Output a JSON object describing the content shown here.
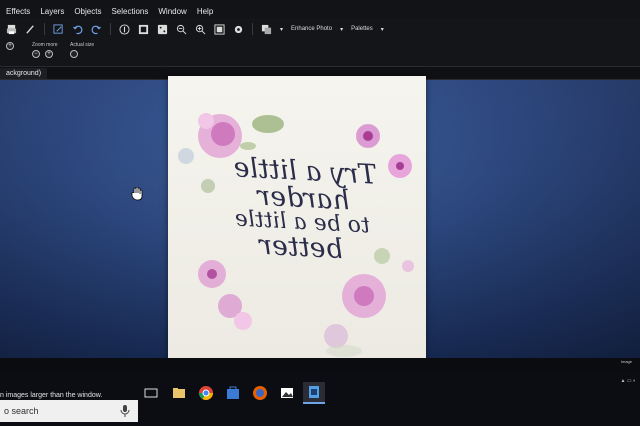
{
  "menu": {
    "items": [
      "Effects",
      "Layers",
      "Objects",
      "Selections",
      "Window",
      "Help"
    ]
  },
  "toolbar": {
    "enhance_label": "Enhance Photo",
    "palettes_label": "Palettes"
  },
  "options": {
    "zoom_label": "Zoom more",
    "actual_label": "Actual size",
    "zoom_out_glyph": "−",
    "zoom_in_glyph": "+"
  },
  "tab": {
    "label": "ackground)"
  },
  "artwork": {
    "line1": "Try a little",
    "line2": "harder",
    "line3": "to be a little",
    "line4": "better"
  },
  "status": {
    "hint": "n images larger than the window.",
    "image_info": "Image"
  },
  "taskbar": {
    "search_placeholder": "o search",
    "apps": [
      "task-view",
      "file-explorer",
      "chrome",
      "store",
      "firefox",
      "photos",
      "paintshop"
    ]
  },
  "colors": {
    "workspace": "#2b4b8a",
    "menubar": "#121316",
    "accent": "#6fa3e8"
  }
}
